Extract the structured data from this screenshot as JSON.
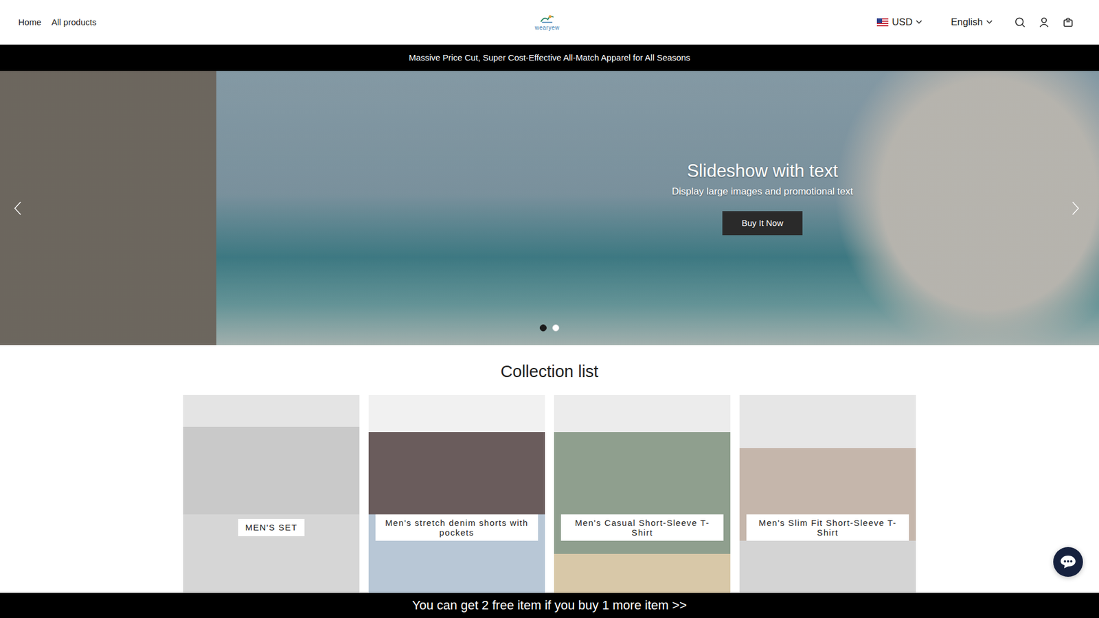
{
  "header": {
    "nav": [
      {
        "label": "Home"
      },
      {
        "label": "All products"
      }
    ],
    "logo": "wearyew",
    "currency": "USD",
    "language": "English"
  },
  "announcement": "Massive Price Cut, Super Cost-Effective All-Match Apparel for All Seasons",
  "hero": {
    "title": "Slideshow with text",
    "subtitle": "Display large images and promotional text",
    "button": "Buy It Now",
    "dots": [
      {
        "selected": true
      },
      {
        "selected": false
      }
    ]
  },
  "collection": {
    "title": "Collection list",
    "cards": [
      {
        "label": "MEN'S SET"
      },
      {
        "label": "Men's stretch denim shorts with pockets"
      },
      {
        "label": "Men's Casual Short-Sleeve T-Shirt"
      },
      {
        "label": "Men's Slim Fit Short-Sleeve T-Shirt"
      }
    ]
  },
  "promo_bar": "You can get 2 free item if you buy 1 more item >>"
}
